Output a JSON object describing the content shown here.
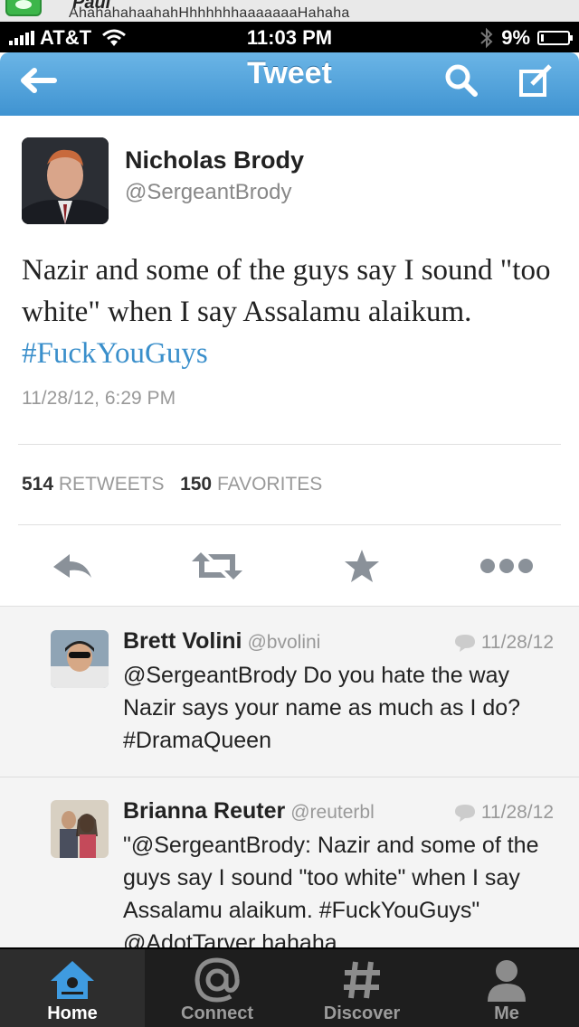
{
  "notification": {
    "sender": "Paul",
    "message": "AhahahahaahahHhhhhhhaaaaaaaHahaha"
  },
  "status_bar": {
    "carrier": "AT&T",
    "time": "11:03 PM",
    "battery": "9%",
    "battery_level": 0.09
  },
  "nav": {
    "title": "Tweet",
    "icons": [
      "back-arrow-icon",
      "search-icon",
      "compose-icon"
    ]
  },
  "tweet": {
    "author_name": "Nicholas Brody",
    "author_handle": "@SergeantBrody",
    "text": "Nazir and some of the guys say I sound \"too white\" when I say Assalamu alaikum.",
    "hashtag": "#FuckYouGuys",
    "timestamp": "11/28/12, 6:29 PM",
    "retweet_count": "514",
    "retweet_label": "RETWEETS",
    "favorite_count": "150",
    "favorite_label": "FAVORITES"
  },
  "actions": [
    "reply-icon",
    "retweet-icon",
    "favorite-icon",
    "more-icon"
  ],
  "replies": [
    {
      "name": "Brett Volini",
      "handle": "@bvolini",
      "date": "11/28/12",
      "text": "@SergeantBrody Do you hate the way Nazir says your name as much as I do? #DramaQueen"
    },
    {
      "name": "Brianna Reuter",
      "handle": "@reuterbl",
      "date": "11/28/12",
      "text": "\"@SergeantBrody: Nazir and some of the guys say I sound \"too white\" when I say Assalamu alaikum. #FuckYouGuys\" @AdotTarver hahaha"
    }
  ],
  "tabs": [
    {
      "label": "Home",
      "icon": "home-icon",
      "active": true
    },
    {
      "label": "Connect",
      "icon": "at-icon",
      "active": false
    },
    {
      "label": "Discover",
      "icon": "hash-icon",
      "active": false
    },
    {
      "label": "Me",
      "icon": "person-icon",
      "active": false
    }
  ],
  "colors": {
    "nav_blue": "#4a9ed9",
    "hashtag": "#3a8fcb",
    "tab_bg": "#1e1e1e"
  }
}
